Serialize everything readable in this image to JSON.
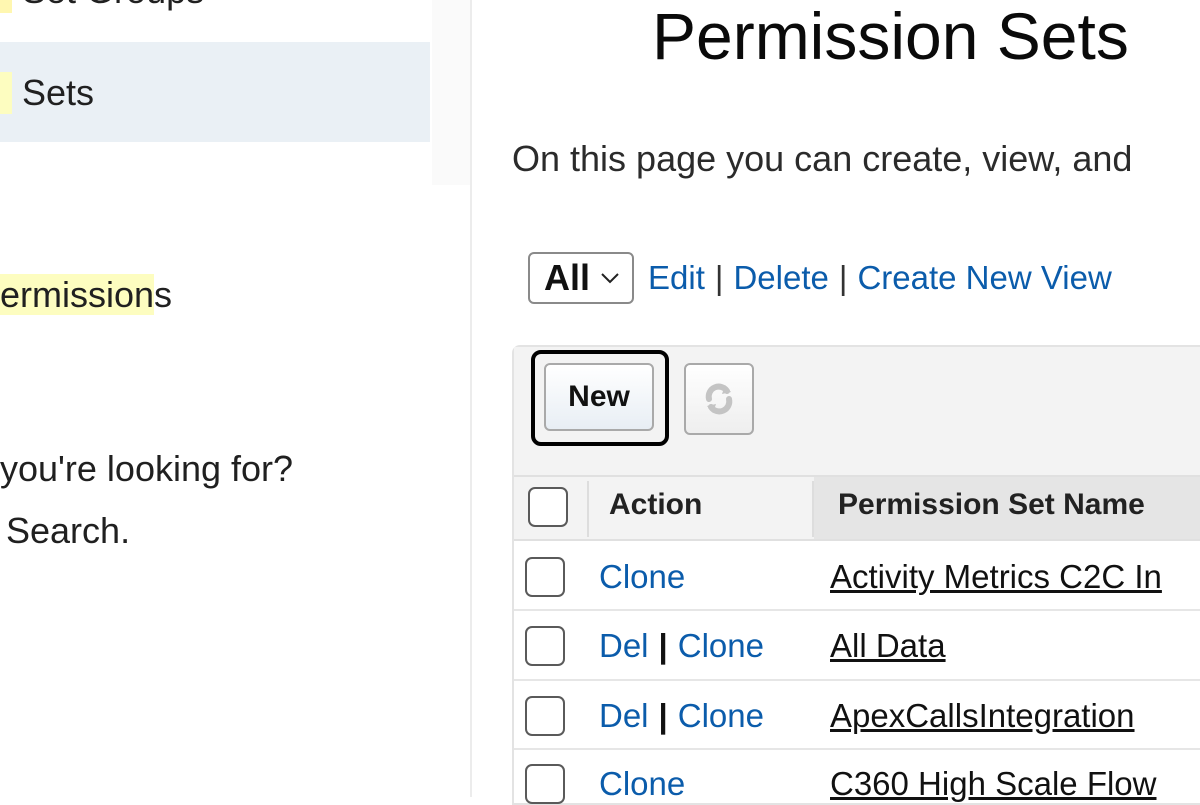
{
  "sidebar": {
    "top_item_label": "Set Groups",
    "selected_item_label": "Sets",
    "permissions_link_highlight": "ermission",
    "permissions_link_tail": "s",
    "help_line1": "you're looking for?",
    "help_line2": "Search."
  },
  "main": {
    "title": "Permission Sets",
    "description": "On this page you can create, view, and",
    "view": {
      "selected": "All",
      "edit_label": "Edit",
      "delete_label": "Delete",
      "create_view_label": "Create New View",
      "separator": "|"
    },
    "toolbar": {
      "new_label": "New",
      "refresh_icon": "refresh-icon"
    },
    "table": {
      "columns": [
        "Action",
        "Permission Set Name"
      ],
      "rows": [
        {
          "actions": [
            "Clone"
          ],
          "name": "Activity Metrics C2C In"
        },
        {
          "actions": [
            "Del",
            "Clone"
          ],
          "name": "All Data"
        },
        {
          "actions": [
            "Del",
            "Clone"
          ],
          "name": "ApexCallsIntegration"
        },
        {
          "actions": [
            "Clone"
          ],
          "name": "C360 High Scale Flow"
        }
      ]
    }
  },
  "colors": {
    "link": "#0b5cab",
    "highlight": "#fdfdc0",
    "selected_sidebar": "#eaf0f5"
  }
}
